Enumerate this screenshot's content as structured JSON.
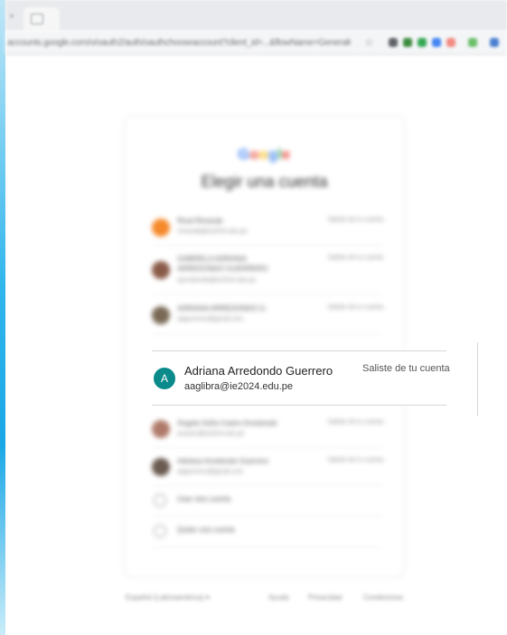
{
  "browser": {
    "tab_close_glyph": "×",
    "address_text": "accounts.google.com/o/oauth2/auth/oauthchooseaccount?client_id=...&flowName=GeneralOAuthFlow",
    "extension_colors": [
      "#5f6368",
      "#3c8b3c",
      "#34a853",
      "#4285f4",
      "#f28b82",
      "#6bbf6b",
      "#4a7fd1"
    ]
  },
  "card": {
    "logo": [
      "G",
      "o",
      "o",
      "g",
      "l",
      "e"
    ],
    "title": "Elegir una cuenta",
    "accounts": [
      {
        "name": "Rival Rimarab",
        "email": "rrimarab@ie2024.edu.pe",
        "status": "Saliste de tu cuenta",
        "avatar_color": "#f5892a"
      },
      {
        "name": "GABRIELA ADRIANA ARREDONDO GUERRERO",
        "email": "aarredondo@ie2024.edu.pe",
        "status": "Saliste de tu cuenta",
        "avatar_color": "#8a5a48"
      },
      {
        "name": "ADRIANA ARREDONDO G.",
        "email": "aaguerrero@gmail.com",
        "status": "Saliste de tu cuenta",
        "avatar_color": "#7a6a55"
      },
      {
        "name": "Ángela Sofía Castro Arredondo",
        "email": "acastro@ie2024.edu.pe",
        "status": "Saliste de tu cuenta",
        "avatar_color": "#b07a6a"
      },
      {
        "name": "Adriana Arredondo Guerrero",
        "email": "aaguerrero@gmail.com",
        "status": "Saliste de tu cuenta",
        "avatar_color": "#6a5a50"
      }
    ],
    "actions": [
      {
        "label": "Usar otra cuenta"
      },
      {
        "label": "Quitar una cuenta"
      }
    ]
  },
  "focused_account": {
    "avatar_letter": "A",
    "name": "Adriana Arredondo Guerrero",
    "email": "aaglibra@ie2024.edu.pe",
    "status": "Saliste de tu cuenta",
    "avatar_color": "#0a8a8a"
  },
  "footer": {
    "language": "Español (Latinoamérica) ▾",
    "links": [
      "Ayuda",
      "Privacidad",
      "Condiciones"
    ]
  }
}
